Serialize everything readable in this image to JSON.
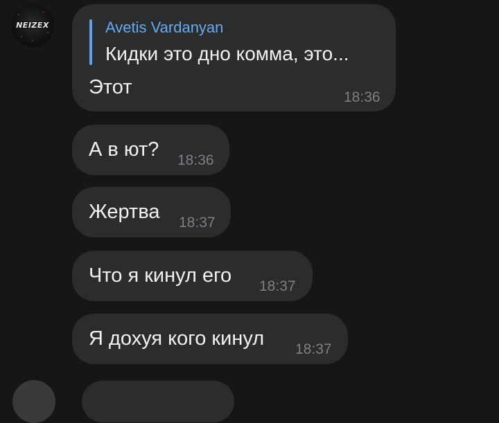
{
  "avatar": {
    "label": "NEIZEX"
  },
  "messages": [
    {
      "reply": {
        "author": "Avetis Vardanyan",
        "text": "Кидки это дно комма, это..."
      },
      "text": "Этот",
      "time": "18:36"
    },
    {
      "text": "А в ют?",
      "time": "18:36"
    },
    {
      "text": "Жертва",
      "time": "18:37"
    },
    {
      "text": "Что я кинул его",
      "time": "18:37"
    },
    {
      "text": "Я дохуя кого кинул",
      "time": "18:37"
    }
  ]
}
